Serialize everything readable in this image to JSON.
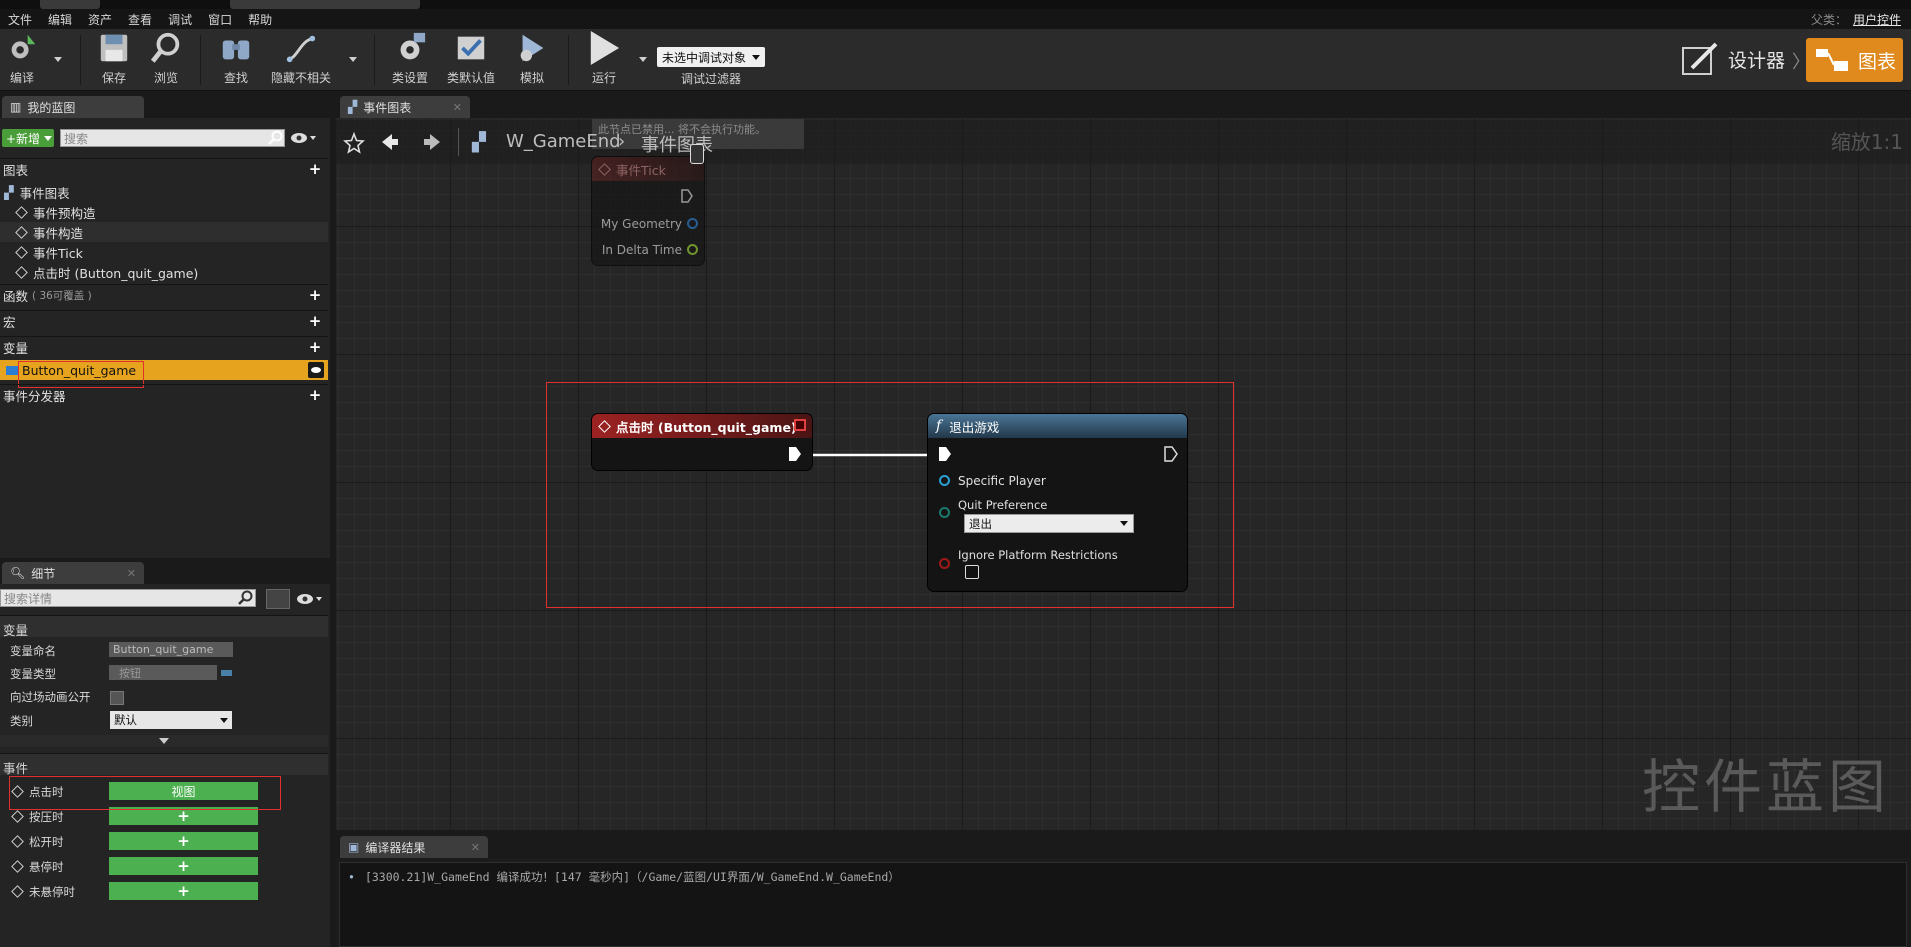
{
  "menu": [
    "文件",
    "编辑",
    "资产",
    "查看",
    "调试",
    "窗口",
    "帮助"
  ],
  "parent": {
    "label": "父类：",
    "value": "用户控件"
  },
  "toolbar": {
    "compile": "编译",
    "save": "保存",
    "browse": "浏览",
    "find": "查找",
    "hide_unrelated": "隐藏不相关",
    "class_settings": "类设置",
    "class_defaults": "类默认值",
    "simulate": "模拟",
    "run": "运行",
    "debug_object": "未选中调试对象",
    "debug_filter": "调试过滤器"
  },
  "modes": {
    "designer": "设计器",
    "graph": "图表"
  },
  "my_blueprint": {
    "tab": "我的蓝图",
    "new": "+新增",
    "search_placeholder": "搜索",
    "graphs": "图表",
    "event_graph": "事件图表",
    "events": [
      "事件预构造",
      "事件构造",
      "事件Tick",
      "点击时 (Button_quit_game)"
    ],
    "functions": "函数",
    "functions_note": "( 36可覆盖 )",
    "macros": "宏",
    "variables": "变量",
    "variable_selected": "Button_quit_game",
    "dispatchers": "事件分发器"
  },
  "details": {
    "tab": "细节",
    "search_placeholder": "搜索详情",
    "variable_section": "变量",
    "name_label": "变量命名",
    "name_value": "Button_quit_game",
    "type_label": "变量类型",
    "type_value": "按钮",
    "expose_label": "向过场动画公开",
    "category_label": "类别",
    "category_value": "默认",
    "events_section": "事件",
    "events": [
      {
        "label": "点击时",
        "btn": "视图"
      },
      {
        "label": "按压时",
        "btn": "+"
      },
      {
        "label": "松开时",
        "btn": "+"
      },
      {
        "label": "悬停时",
        "btn": "+"
      },
      {
        "label": "未悬停时",
        "btn": "+"
      }
    ]
  },
  "graph": {
    "tab": "事件图表",
    "crumb_root": "W_GameEnd",
    "crumb_leaf": "事件图表",
    "zoom": "缩放1:1",
    "tooltip": "此节点已禁用... 将不会执行功能。",
    "tick": {
      "title": "事件Tick",
      "pins": [
        "My Geometry",
        "In Delta Time"
      ]
    },
    "click": {
      "title": "点击时 (Button_quit_game)"
    },
    "quit": {
      "title": "退出游戏",
      "pins": [
        "Specific Player",
        "Quit Preference",
        "Ignore Platform Restrictions"
      ],
      "dropdown": "退出"
    },
    "watermark": "控件蓝图"
  },
  "output": {
    "tab": "编译器结果",
    "line": "[3300.21]W_GameEnd 编译成功！[147 毫秒内]（/Game/蓝图/UI界面/W_GameEnd.W_GameEnd）"
  },
  "colors": {
    "accent": "#e08a1e",
    "event_red": "#8a1c1c",
    "func_blue": "#3a5f7e",
    "green_btn": "#4caf50"
  }
}
